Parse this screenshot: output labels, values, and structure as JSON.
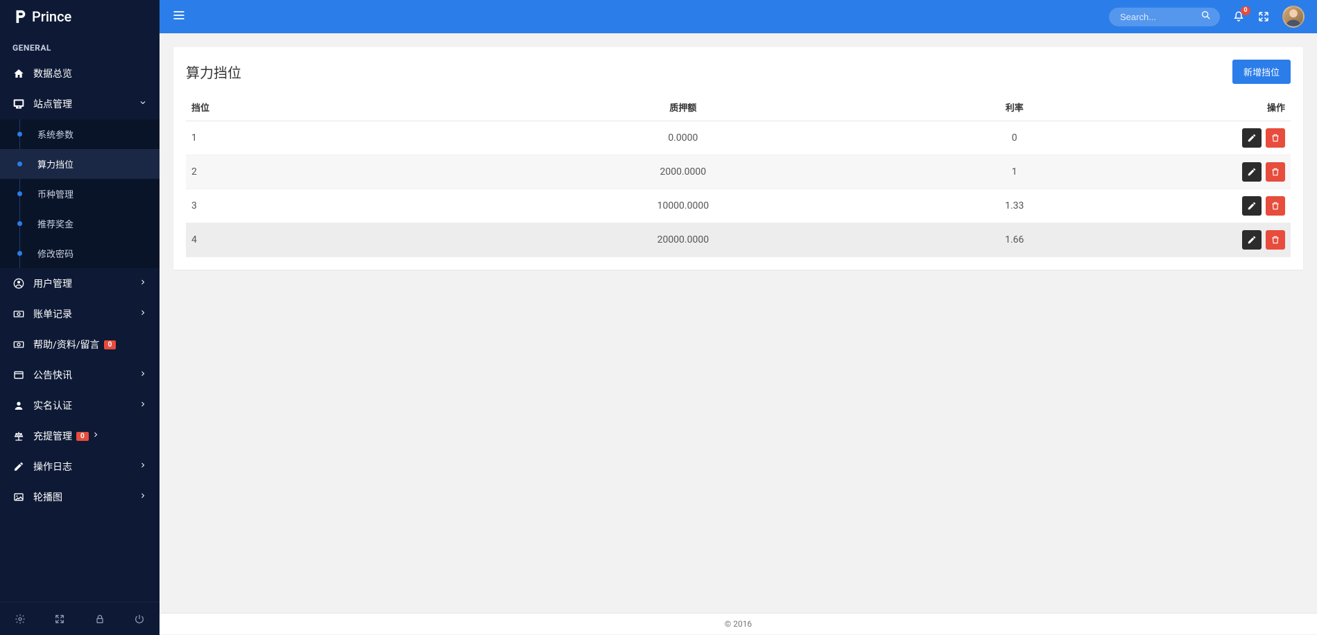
{
  "brand": "Prince",
  "header": {
    "search_placeholder": "Search...",
    "notif_count": "0"
  },
  "sidebar": {
    "section_label": "GENERAL",
    "items": [
      {
        "icon": "home",
        "label": "数据总览",
        "type": "link"
      },
      {
        "icon": "desktop",
        "label": "站点管理",
        "type": "submenu",
        "expanded": true,
        "children": [
          {
            "label": "系统参数"
          },
          {
            "label": "算力挡位",
            "active": true
          },
          {
            "label": "币种管理"
          },
          {
            "label": "推荐奖金"
          },
          {
            "label": "修改密码"
          }
        ]
      },
      {
        "icon": "user-circle",
        "label": "用户管理",
        "type": "expand"
      },
      {
        "icon": "money",
        "label": "账单记录",
        "type": "expand"
      },
      {
        "icon": "money",
        "label": "帮助/资料/留言",
        "type": "badge",
        "badge": "0"
      },
      {
        "icon": "window",
        "label": "公告快讯",
        "type": "expand"
      },
      {
        "icon": "user",
        "label": "实名认证",
        "type": "expand"
      },
      {
        "icon": "balance",
        "label": "充提管理",
        "type": "badge-expand",
        "badge": "0"
      },
      {
        "icon": "edit",
        "label": "操作日志",
        "type": "expand"
      },
      {
        "icon": "image",
        "label": "轮播图",
        "type": "expand"
      }
    ]
  },
  "page": {
    "title": "算力挡位",
    "add_button": "新增挡位",
    "columns": {
      "level": "挡位",
      "amount": "质押额",
      "rate": "利率",
      "actions": "操作"
    },
    "rows": [
      {
        "level": "1",
        "amount": "0.0000",
        "rate": "0"
      },
      {
        "level": "2",
        "amount": "2000.0000",
        "rate": "1"
      },
      {
        "level": "3",
        "amount": "10000.0000",
        "rate": "1.33"
      },
      {
        "level": "4",
        "amount": "20000.0000",
        "rate": "1.66"
      }
    ]
  },
  "footer": "© 2016"
}
